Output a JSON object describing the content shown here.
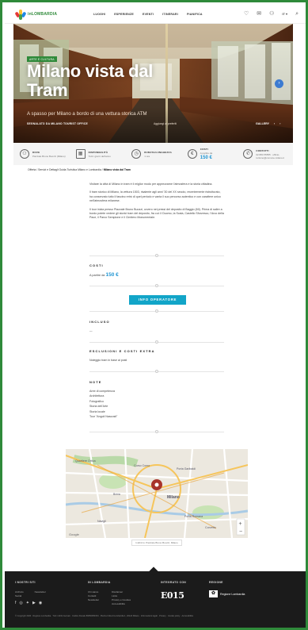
{
  "header": {
    "logo_text": "inLOMBARDIA",
    "nav": [
      "LUOGHI",
      "ESPERIENZE",
      "EVENTI",
      "ITINERARI",
      "PIANIFICA"
    ],
    "lang": "IT ▾"
  },
  "hero": {
    "tag": "ARTE E CULTURA",
    "title": "Milano vista dal Tram",
    "subtitle": "A spasso per Milano a bordo di una vettura storica ATM",
    "bar_left": "SEGNALATO DA MILANO TOURIST OFFICE",
    "bar_right": "Aggiungi ai preferiti",
    "ctrl_label": "GALLERY",
    "ctrl_prev": "‹",
    "ctrl_next": "›"
  },
  "info_strip": [
    {
      "icon": "person-icon",
      "glyph": "⚇",
      "label": "DOVE",
      "value": "Piazzale Bruno Buozzi (Milano)"
    },
    {
      "icon": "calendar-icon",
      "glyph": "▦",
      "label": "DISPONIBILITÀ",
      "value": "Tutti i giorni dell'anno"
    },
    {
      "icon": "clock-icon",
      "glyph": "◷",
      "label": "DURATA/LUNGHEZZA",
      "value": "1 ora"
    },
    {
      "icon": "euro-icon",
      "glyph": "€",
      "label": "COSTI",
      "value": "A partire da",
      "price": "150 €"
    },
    {
      "icon": "phone-icon",
      "glyph": "✆",
      "label": "CONTATTI",
      "value": "02 884 55555 · ufficio-turismo@comune.milano.it"
    }
  ],
  "breadcrumb": {
    "path": "Offerta / Servizi e Dettagli Guida Turistica Milano e Lombardia /",
    "current": "Milano vista dal Tram"
  },
  "description": [
    "Visitare la città di Milano in tram è il miglior modo per apprezzarne l'atmosfera e la storia cittadina.",
    "Il tram storico di Milano, la vettura 1503, risalente agli anni '30 del XX secolo, recentemente ristrutturato, ha conservato tutto il fascino retrò di quel periodo e vanta il suo percorso autentico e con carattere unico nell'atmosfera milanese.",
    "Il tour inizia presso Piazzale Bruno Buozzi, ovvero nei pressi del deposito di Baggio (MI). Prima di salire a bordo potete vedere gli storici tram del deposito, fra cui: il Duomo, la Scala, Castello Sforzesco, l'Arco della Pace, il Parco Sempione e il Cimitero Monumentale."
  ],
  "costs": {
    "title": "COSTI",
    "prefix": "A partire da",
    "price": "150 €"
  },
  "button": {
    "label": "INFO OPERATORE"
  },
  "included": {
    "title": "INCLUSO",
    "text": "—"
  },
  "excluded": {
    "title": "ESCLUSIONI E COSTI EXTRA",
    "text": "Noleggio tram in base ai posti"
  },
  "notes": {
    "title": "NOTE",
    "items": [
      "Aree di competenza",
      "Architettura",
      "Fotografico",
      "Storia dell'Arte",
      "Storia locale",
      "Tour \"Angoli Nascosti\""
    ]
  },
  "map": {
    "labels": [
      "Quartiere Ortica",
      "Corso Como",
      "Porta Garibaldi",
      "Brera",
      "Milano",
      "Porta Romana",
      "Navigli",
      "Corvetto"
    ],
    "attribution": "Google",
    "note": "Indirizzo: Piazzale Bruno Buozzi, Milano"
  },
  "footer": {
    "col1": {
      "title": "I NOSTRI SITI",
      "links": [
        "Archivio",
        "Newsletter",
        "Social"
      ]
    },
    "col2": {
      "title": "IN LOMBARDIA",
      "links": [
        "Chi siamo",
        "Contatti",
        "Newsletter",
        "Disclaimer",
        "Links",
        "Privacy e Cookies",
        "Accessibilità"
      ]
    },
    "col3": {
      "title": "INTEGRATO CON",
      "brand": "E015"
    },
    "col4": {
      "title": "REGIONE",
      "brand": "Regione Lombardia"
    },
    "social": [
      "f",
      "◎",
      "✦",
      "▶",
      "◉"
    ],
    "legal": "© Copyright 2020 · Regione Lombardia · Tutti i diritti riservati · Codice Fiscale 80050050154 · Piazza Città di Lombardia 1, 20124 Milano · Informazioni legali · Privacy · Cookie policy · Accessibilità"
  }
}
